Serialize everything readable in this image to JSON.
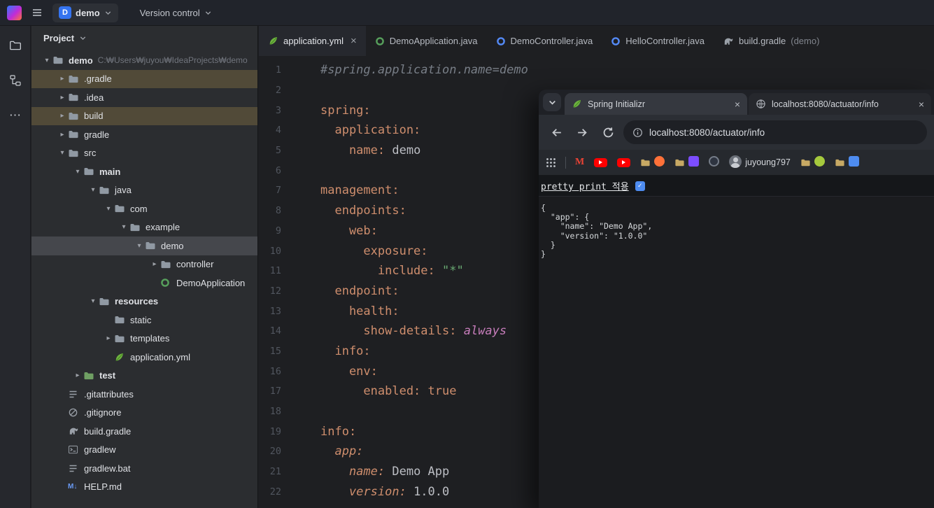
{
  "colors": {
    "accent_blue": "#3574f0",
    "spring_green": "#6db33f",
    "excluded_row_brown": "#514a38",
    "selected_row_gray": "#45474c",
    "yaml_key_orange": "#cf8e6d",
    "yaml_string_green": "#6aab73",
    "yaml_keyword_purple": "#c77dbb",
    "youtube_red": "#ff0000",
    "checkbox_blue": "#4e8cf0"
  },
  "title_bar": {
    "app_icon": "intellij-idea-logo",
    "menu_icon": "hamburger-menu",
    "project": {
      "initial": "D",
      "name": "demo"
    },
    "vcs_label": "Version control"
  },
  "tool_strip": {
    "icons": [
      "project-tool-icon",
      "structure-tool-icon",
      "more-icon"
    ]
  },
  "project_panel": {
    "header": "Project",
    "tree": [
      {
        "label": "demo",
        "path": "C:₩Users₩juyou₩IdeaProjects₩demo",
        "indent": 0,
        "chevron": "down",
        "icon": "folder",
        "bold": true
      },
      {
        "label": ".gradle",
        "indent": 1,
        "chevron": "right",
        "icon": "folder",
        "highlight": "excluded"
      },
      {
        "label": ".idea",
        "indent": 1,
        "chevron": "right",
        "icon": "folder"
      },
      {
        "label": "build",
        "indent": 1,
        "chevron": "right",
        "icon": "folder",
        "highlight": "excluded"
      },
      {
        "label": "gradle",
        "indent": 1,
        "chevron": "right",
        "icon": "folder"
      },
      {
        "label": "src",
        "indent": 1,
        "chevron": "down",
        "icon": "folder"
      },
      {
        "label": "main",
        "indent": 2,
        "chevron": "down",
        "icon": "folder-source",
        "bold": true
      },
      {
        "label": "java",
        "indent": 3,
        "chevron": "down",
        "icon": "folder"
      },
      {
        "label": "com",
        "indent": 4,
        "chevron": "down",
        "icon": "package"
      },
      {
        "label": "example",
        "indent": 5,
        "chevron": "down",
        "icon": "package"
      },
      {
        "label": "demo",
        "indent": 6,
        "chevron": "down",
        "icon": "package",
        "selected": true
      },
      {
        "label": "controller",
        "indent": 7,
        "chevron": "right",
        "icon": "package"
      },
      {
        "label": "DemoApplication",
        "indent": 7,
        "chevron": "none",
        "icon": "class-spring"
      },
      {
        "label": "resources",
        "indent": 3,
        "chevron": "down",
        "icon": "folder-resources",
        "bold": true
      },
      {
        "label": "static",
        "indent": 4,
        "chevron": "none",
        "icon": "folder"
      },
      {
        "label": "templates",
        "indent": 4,
        "chevron": "right",
        "icon": "folder"
      },
      {
        "label": "application.yml",
        "indent": 4,
        "chevron": "none",
        "icon": "spring-leaf"
      },
      {
        "label": "test",
        "indent": 2,
        "chevron": "right",
        "icon": "folder-test",
        "bold": true
      },
      {
        "label": ".gitattributes",
        "indent": 1,
        "chevron": "none",
        "icon": "file-lines"
      },
      {
        "label": ".gitignore",
        "indent": 1,
        "chevron": "none",
        "icon": "ignore"
      },
      {
        "label": "build.gradle",
        "indent": 1,
        "chevron": "none",
        "icon": "gradle"
      },
      {
        "label": "gradlew",
        "indent": 1,
        "chevron": "none",
        "icon": "console"
      },
      {
        "label": "gradlew.bat",
        "indent": 1,
        "chevron": "none",
        "icon": "file-lines"
      },
      {
        "label": "HELP.md",
        "indent": 1,
        "chevron": "none",
        "icon": "markdown"
      }
    ]
  },
  "editor": {
    "tabs": [
      {
        "label": "application.yml",
        "icon": "spring-leaf",
        "active": true,
        "closable": true
      },
      {
        "label": "DemoApplication.java",
        "icon": "boot-class"
      },
      {
        "label": "DemoController.java",
        "icon": "controller-class"
      },
      {
        "label": "HelloController.java",
        "icon": "controller-class"
      },
      {
        "label": "build.gradle",
        "suffix": "(demo)",
        "icon": "gradle"
      }
    ],
    "lines": [
      {
        "n": 1,
        "seg": [
          {
            "t": "#spring.application.name=demo",
            "c": "comment"
          }
        ]
      },
      {
        "n": 2,
        "seg": []
      },
      {
        "n": 3,
        "seg": [
          {
            "t": "spring:",
            "c": "key"
          }
        ]
      },
      {
        "n": 4,
        "seg": [
          {
            "t": "  application:",
            "c": "key"
          }
        ]
      },
      {
        "n": 5,
        "seg": [
          {
            "t": "    name:",
            "c": "key"
          },
          {
            "t": " demo",
            "c": "text"
          }
        ]
      },
      {
        "n": 6,
        "seg": []
      },
      {
        "n": 7,
        "seg": [
          {
            "t": "management:",
            "c": "key"
          }
        ]
      },
      {
        "n": 8,
        "seg": [
          {
            "t": "  endpoints:",
            "c": "key"
          }
        ]
      },
      {
        "n": 9,
        "seg": [
          {
            "t": "    web:",
            "c": "key"
          }
        ]
      },
      {
        "n": 10,
        "seg": [
          {
            "t": "      exposure:",
            "c": "key"
          }
        ]
      },
      {
        "n": 11,
        "seg": [
          {
            "t": "        include: ",
            "c": "key"
          },
          {
            "t": "\"*\"",
            "c": "string"
          }
        ]
      },
      {
        "n": 12,
        "seg": [
          {
            "t": "  endpoint:",
            "c": "key"
          }
        ]
      },
      {
        "n": 13,
        "seg": [
          {
            "t": "    health:",
            "c": "key"
          }
        ]
      },
      {
        "n": 14,
        "seg": [
          {
            "t": "      show-details: ",
            "c": "key"
          },
          {
            "t": "always",
            "c": "keyword"
          }
        ]
      },
      {
        "n": 15,
        "seg": [
          {
            "t": "  info:",
            "c": "key"
          }
        ]
      },
      {
        "n": 16,
        "seg": [
          {
            "t": "    env:",
            "c": "key"
          }
        ]
      },
      {
        "n": 17,
        "seg": [
          {
            "t": "      enabled: ",
            "c": "key"
          },
          {
            "t": "true",
            "c": "bool"
          }
        ]
      },
      {
        "n": 18,
        "seg": []
      },
      {
        "n": 19,
        "seg": [
          {
            "t": "info:",
            "c": "key"
          }
        ]
      },
      {
        "n": 20,
        "seg": [
          {
            "t": "  app:",
            "c": "key-italic"
          }
        ]
      },
      {
        "n": 21,
        "seg": [
          {
            "t": "    name:",
            "c": "key-italic"
          },
          {
            "t": " Demo App",
            "c": "text"
          }
        ]
      },
      {
        "n": 22,
        "seg": [
          {
            "t": "    version:",
            "c": "key-italic"
          },
          {
            "t": " 1.0.0",
            "c": "text"
          }
        ]
      }
    ]
  },
  "browser": {
    "tabs": [
      {
        "label": "Spring Initializr",
        "icon": "spring-leaf",
        "active": true
      },
      {
        "label": "localhost:8080/actuator/info",
        "icon": "globe",
        "active": false
      }
    ],
    "nav": {
      "url": "localhost:8080/actuator/info"
    },
    "bookmarks": [
      {
        "icon": "gmail"
      },
      {
        "icon": "youtube"
      },
      {
        "icon": "youtube"
      },
      {
        "icon": "bookmark-folder",
        "badge": "orange"
      },
      {
        "icon": "bookmark-folder",
        "badge": "purple"
      },
      {
        "icon": "globe-dark"
      },
      {
        "icon": "avatar",
        "label": "juyoung797"
      },
      {
        "icon": "bookmark-folder",
        "badge": "green"
      },
      {
        "icon": "bookmark-folder",
        "badge": "blue"
      }
    ],
    "pretty_print": {
      "label": "pretty print 적용",
      "checked": true
    },
    "json_lines": [
      "{",
      "  \"app\": {",
      "    \"name\": \"Demo App\",",
      "    \"version\": \"1.0.0\"",
      "  }",
      "}"
    ]
  }
}
